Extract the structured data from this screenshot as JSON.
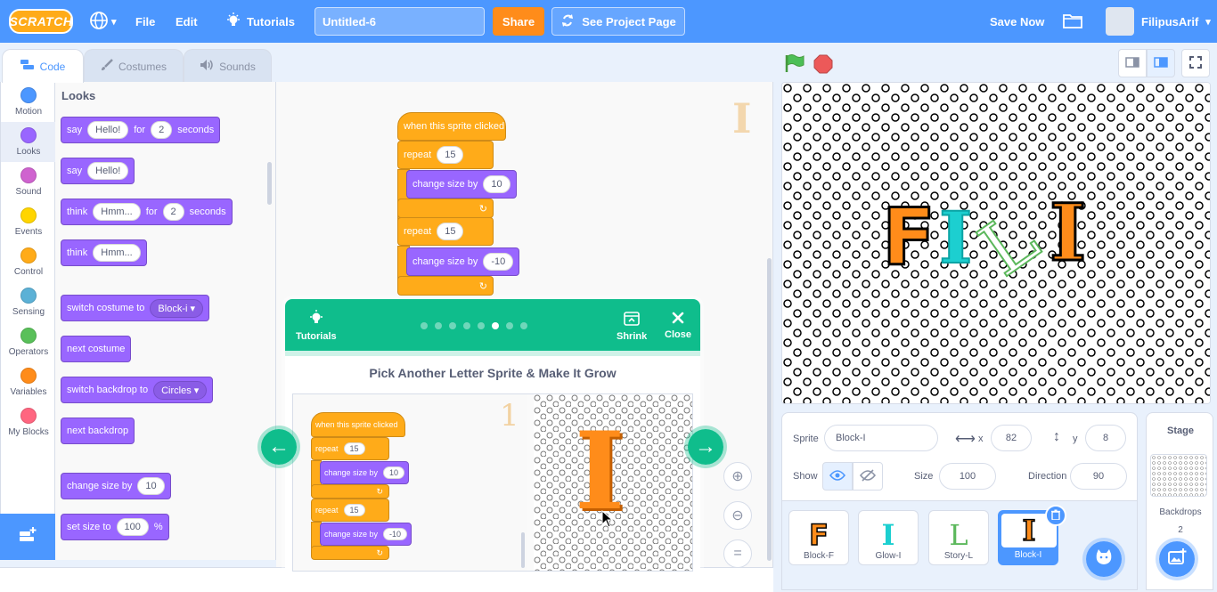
{
  "menu": {
    "logo": "SCRATCH",
    "globe_arrow": "▾",
    "file": "File",
    "edit": "Edit",
    "tutorials": "Tutorials",
    "project_title": "Untitled-6",
    "share": "Share",
    "see_project": "See Project Page",
    "save_now": "Save Now",
    "username": "FilipusArif"
  },
  "tabs": {
    "code": "Code",
    "costumes": "Costumes",
    "sounds": "Sounds"
  },
  "categories": [
    {
      "label": "Motion",
      "color": "#4c97ff"
    },
    {
      "label": "Looks",
      "color": "#9966ff"
    },
    {
      "label": "Sound",
      "color": "#cf63cf"
    },
    {
      "label": "Events",
      "color": "#ffd500"
    },
    {
      "label": "Control",
      "color": "#ffab19"
    },
    {
      "label": "Sensing",
      "color": "#5cb1d6"
    },
    {
      "label": "Operators",
      "color": "#59c059"
    },
    {
      "label": "Variables",
      "color": "#ff8c1a"
    },
    {
      "label": "My Blocks",
      "color": "#ff6680"
    }
  ],
  "palette": {
    "title": "Looks",
    "say_for": {
      "say": "say",
      "msg": "Hello!",
      "for": "for",
      "secs": "2",
      "seconds": "seconds"
    },
    "say": {
      "say": "say",
      "msg": "Hello!"
    },
    "think_for": {
      "think": "think",
      "msg": "Hmm...",
      "for": "for",
      "secs": "2",
      "seconds": "seconds"
    },
    "think": {
      "think": "think",
      "msg": "Hmm..."
    },
    "switch_costume": {
      "label": "switch costume to",
      "value": "Block-i"
    },
    "next_costume": "next costume",
    "switch_backdrop": {
      "label": "switch backdrop to",
      "value": "Circles"
    },
    "next_backdrop": "next backdrop",
    "change_size": {
      "label": "change size by",
      "value": "10"
    },
    "set_size": {
      "label": "set size to",
      "value": "100",
      "unit": "%"
    }
  },
  "script": {
    "hat": "when this sprite clicked",
    "repeat1": {
      "label": "repeat",
      "value": "15"
    },
    "change1": {
      "label": "change size by",
      "value": "10"
    },
    "repeat2": {
      "label": "repeat",
      "value": "15"
    },
    "change2": {
      "label": "change size by",
      "value": "-10"
    },
    "loop_arrow": "↻"
  },
  "workspace": {
    "sprite_letter": "I"
  },
  "tutorial": {
    "tutorials_label": "Tutorials",
    "shrink": "Shrink",
    "close": "Close",
    "title": "Pick Another Letter Sprite & Make It Grow",
    "step_count": 8,
    "active_step": 6,
    "img": {
      "hat": "when this sprite clicked",
      "repeat1": "repeat",
      "r1v": "15",
      "change1": "change size by",
      "c1v": "10",
      "repeat2": "repeat",
      "r2v": "15",
      "change2": "change size by",
      "c2v": "-10",
      "letter": "I",
      "ghost_letter": "1"
    }
  },
  "stage": {
    "letters": [
      "F",
      "I",
      "L",
      "I"
    ]
  },
  "sprite_info": {
    "sprite_label": "Sprite",
    "sprite_name": "Block-I",
    "x_label": "x",
    "x": "82",
    "y_label": "y",
    "y": "8",
    "show_label": "Show",
    "size_label": "Size",
    "size": "100",
    "direction_label": "Direction",
    "direction": "90"
  },
  "sprites": [
    {
      "name": "Block-F",
      "letter": "F",
      "color": "#ff8c1a"
    },
    {
      "name": "Glow-I",
      "letter": "I",
      "color": "#1ccfd0"
    },
    {
      "name": "Story-L",
      "letter": "L",
      "color": "#5cb85c"
    },
    {
      "name": "Block-I",
      "letter": "I",
      "color": "#ff8c1a"
    }
  ],
  "stage_panel": {
    "title": "Stage",
    "backdrops_label": "Backdrops",
    "backdrops_count": "2"
  },
  "icons": {
    "globe": "globe-icon",
    "bulb": "bulb-icon",
    "remix": "remix-icon",
    "folder": "folder-icon",
    "flag": "green-flag-icon",
    "stop": "stop-icon",
    "zoom_in": "zoom-in-icon",
    "zoom_out": "zoom-out-icon"
  }
}
